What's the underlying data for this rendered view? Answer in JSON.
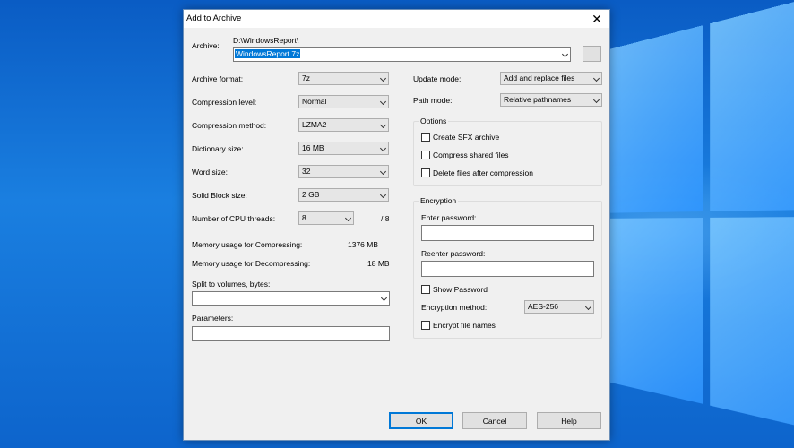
{
  "dialog": {
    "title": "Add to Archive",
    "close_glyph": "✕"
  },
  "archive": {
    "label": "Archive:",
    "path": "D:\\WindowsReport\\",
    "filename": "WindowsReport.7z",
    "browse_label": "..."
  },
  "left": {
    "format_label": "Archive format:",
    "format_value": "7z",
    "level_label": "Compression level:",
    "level_value": "Normal",
    "method_label": "Compression method:",
    "method_value": "LZMA2",
    "dict_label": "Dictionary size:",
    "dict_value": "16 MB",
    "word_label": "Word size:",
    "word_value": "32",
    "solid_label": "Solid Block size:",
    "solid_value": "2 GB",
    "threads_label": "Number of CPU threads:",
    "threads_value": "8",
    "threads_max": "/ 8",
    "mem_comp_label": "Memory usage for Compressing:",
    "mem_comp_value": "1376 MB",
    "mem_decomp_label": "Memory usage for Decompressing:",
    "mem_decomp_value": "18 MB",
    "split_label": "Split to volumes, bytes:",
    "split_value": "",
    "params_label": "Parameters:",
    "params_value": ""
  },
  "right": {
    "update_label": "Update mode:",
    "update_value": "Add and replace files",
    "path_label": "Path mode:",
    "path_value": "Relative pathnames",
    "options_title": "Options",
    "opt_sfx": "Create SFX archive",
    "opt_shared": "Compress shared files",
    "opt_delete": "Delete files after compression",
    "enc_title": "Encryption",
    "enter_pw_label": "Enter password:",
    "reenter_pw_label": "Reenter password:",
    "show_pw": "Show Password",
    "enc_method_label": "Encryption method:",
    "enc_method_value": "AES-256",
    "enc_names": "Encrypt file names"
  },
  "buttons": {
    "ok": "OK",
    "cancel": "Cancel",
    "help": "Help"
  }
}
